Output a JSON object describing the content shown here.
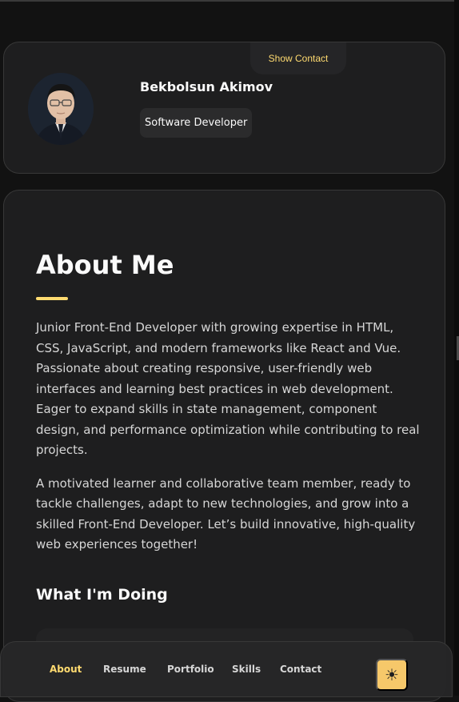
{
  "sidebar": {
    "name": "Bekbolsun Akimov",
    "title": "Software Developer",
    "show_contact_label": "Show Contact",
    "avatar_icon": "avatar-photo"
  },
  "about": {
    "title": "About Me",
    "paragraphs": [
      "Junior Front-End Developer with growing expertise in HTML, CSS, JavaScript, and modern frameworks like React and Vue. Passionate about creating responsive, user-friendly web interfaces and learning best practices in web development. Eager to expand skills in state management, component design, and performance optimization while contributing to real projects.",
      "A motivated learner and collaborative team member, ready to tackle challenges, adapt to new technologies, and grow into a skilled Front-End Developer. Let’s build innovative, high-quality web experiences together!"
    ],
    "doing_title": "What I'm Doing"
  },
  "navbar": {
    "items": [
      "About",
      "Resume",
      "Portfolio",
      "Skills",
      "Contact"
    ],
    "active": "About",
    "theme_toggle_icon": "sun-icon",
    "theme_toggle_glyph": "☀"
  },
  "colors": {
    "accent": "#ffdb70",
    "card_bg": "#1e1e1f",
    "page_bg": "#121212",
    "toggle_bg": "#f6c86a"
  }
}
